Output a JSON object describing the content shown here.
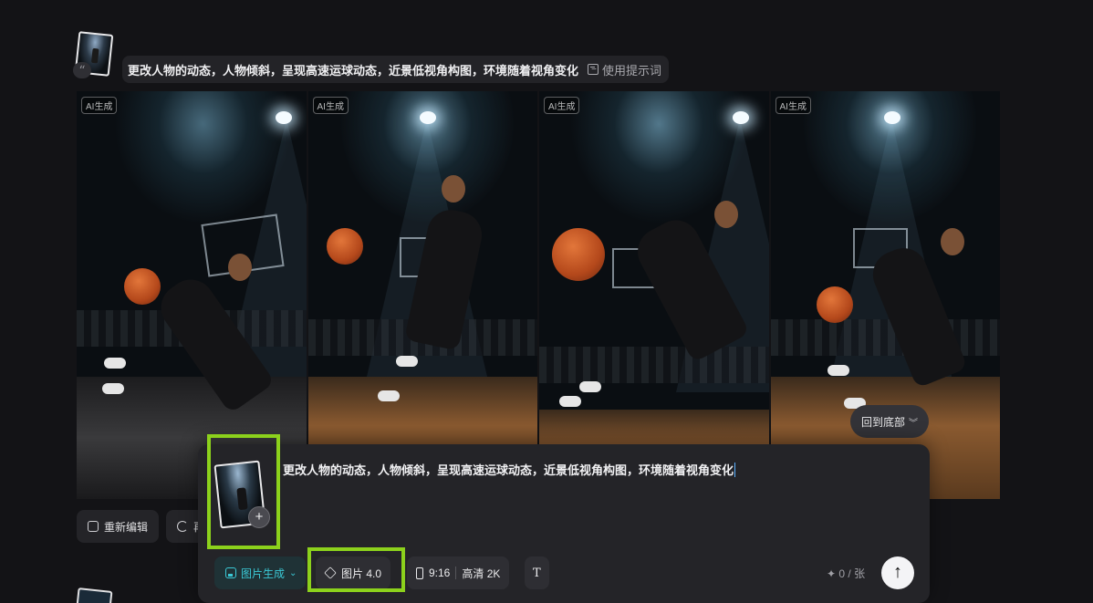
{
  "message": {
    "prompt_text": "更改人物的动态，人物倾斜，呈现高速运球动态，近景低视角构图，环境随着视角变化",
    "use_prompt_label": "使用提示词",
    "quote_glyph": "“",
    "ai_tag": "AI生成",
    "images": [
      {
        "name": "generated-image-1"
      },
      {
        "name": "generated-image-2"
      },
      {
        "name": "generated-image-3"
      },
      {
        "name": "generated-image-4"
      }
    ]
  },
  "actions": {
    "re_edit_label": "重新编辑",
    "regenerate_label": "再"
  },
  "back_to_bottom_label": "回到底部",
  "composer": {
    "input_text": "更改人物的动态，人物倾斜，呈现高速运球动态，近景低视角构图，环境随着视角变化",
    "add_symbol": "+",
    "mode_label": "图片生成",
    "model_label": "图片 4.0",
    "ratio_label": "9:16",
    "quality_label": "高清 2K",
    "text_tool_label": "T",
    "credit_label": "✦ 0 / 张",
    "send_symbol": "↑"
  },
  "colors": {
    "accent": "#3bc9d6",
    "highlight": "#8cd11c",
    "background": "#131316"
  }
}
